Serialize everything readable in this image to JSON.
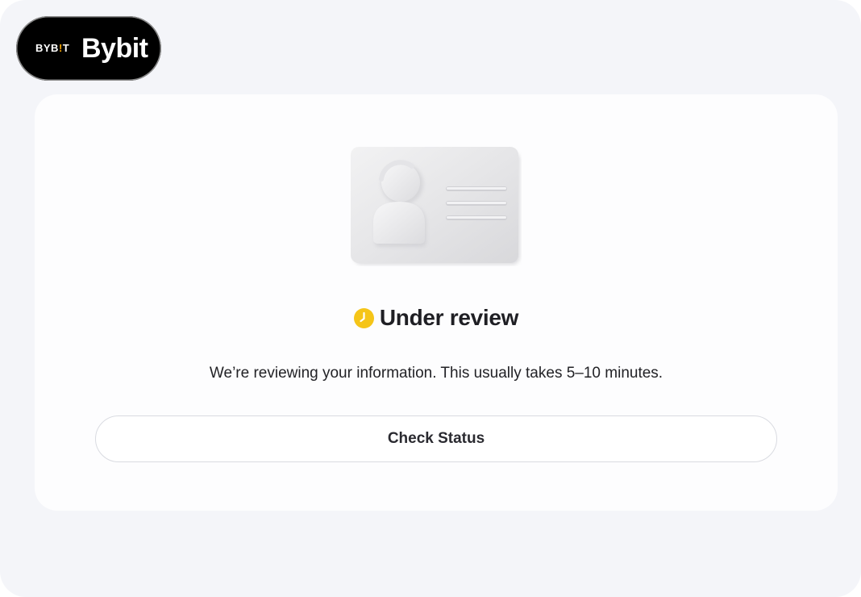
{
  "brand": {
    "logo_text_pre": "BYB",
    "logo_text_accent": "!",
    "logo_text_post": "T",
    "name": "Bybit",
    "accent_color": "#f7a600"
  },
  "review": {
    "illustration_icon": "id-card-icon",
    "status_icon": "clock-icon",
    "status_icon_color": "#f5c518",
    "title": "Under review",
    "description": "We’re reviewing your information. This usually takes 5–10 minutes.",
    "button_label": "Check Status"
  }
}
